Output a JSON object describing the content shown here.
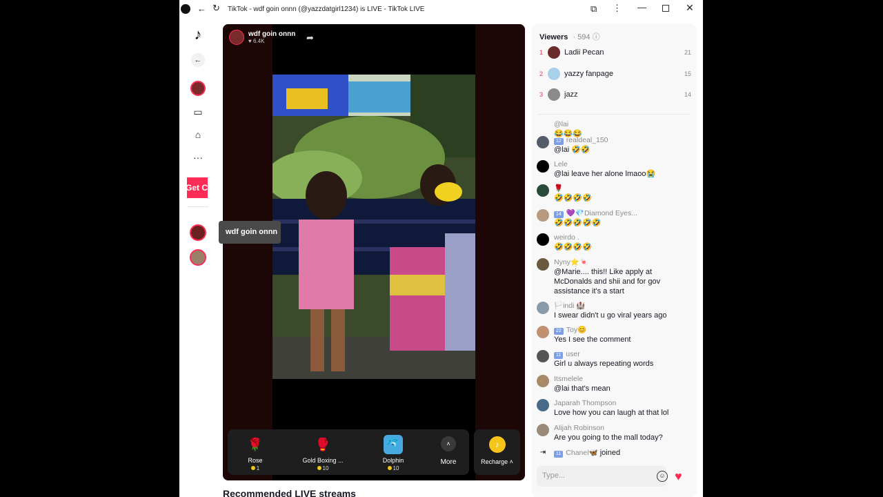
{
  "window": {
    "title": "TikTok - wdf goin onnn (@yazzdatgirl1234) is LIVE - TikTok LIVE"
  },
  "nav": {
    "get_coins_label": "Get Coins"
  },
  "stream": {
    "host_name": "wdf goin onnn",
    "likes": "6.4K",
    "tooltip": "wdf goin onnn"
  },
  "gifts": [
    {
      "name": "Rose",
      "price": "1",
      "icon": "rose-icon"
    },
    {
      "name": "Gold Boxing ...",
      "price": "10",
      "icon": "boxing-glove-icon"
    },
    {
      "name": "Dolphin",
      "price": "10",
      "icon": "dolphin-icon"
    }
  ],
  "more_label": "More",
  "recharge_label": "Recharge",
  "recommended_title": "Recommended LIVE streams",
  "viewers": {
    "title": "Viewers",
    "count": "594",
    "top": [
      {
        "rank": "1",
        "name": "Ladii Pecan",
        "score": "21"
      },
      {
        "rank": "2",
        "name": "yazzy fanpage",
        "score": "15"
      },
      {
        "rank": "3",
        "name": "jazz",
        "score": "14"
      }
    ]
  },
  "chat": [
    {
      "user": "@lai",
      "badge": "",
      "text": "😂😂😂"
    },
    {
      "user": "realdeal_150",
      "badge": "12",
      "text": "@lai 🤣🤣"
    },
    {
      "user": "Lele",
      "badge": "",
      "text": "@lai leave her alone lmaoo😭"
    },
    {
      "user": "🌹",
      "badge": "",
      "text": "🤣🤣🤣🤣"
    },
    {
      "user": "💜💎Diamond Eyes...",
      "badge": "14",
      "text": "🤣🤣🤣🤣🤣"
    },
    {
      "user": "weirdo .",
      "badge": "",
      "text": "🤣🤣🤣🤣"
    },
    {
      "user": "Nyny⭐🍬",
      "badge": "",
      "text": "@Marie.... this!! Like apply at McDonalds and shii and for gov assistance it's a start"
    },
    {
      "user": "🏳️indi 🏰",
      "badge": "",
      "text": "I swear didn't u go viral years ago"
    },
    {
      "user": "Toy😊",
      "badge": "22",
      "text": "Yes I see the comment"
    },
    {
      "user": "user",
      "badge": "11",
      "text": "Girl u always repeating words"
    },
    {
      "user": "Itsmelele",
      "badge": "",
      "text": "@lai that's mean"
    },
    {
      "user": "Japarah Thompson",
      "badge": "",
      "text": "Love how you can laugh at that lol"
    },
    {
      "user": "Alijah Robinson",
      "badge": "",
      "text": "Are you going to the mall today?"
    },
    {
      "user": "Chanel🦋",
      "badge": "11",
      "text": "joined"
    }
  ],
  "input": {
    "placeholder": "Type..."
  }
}
